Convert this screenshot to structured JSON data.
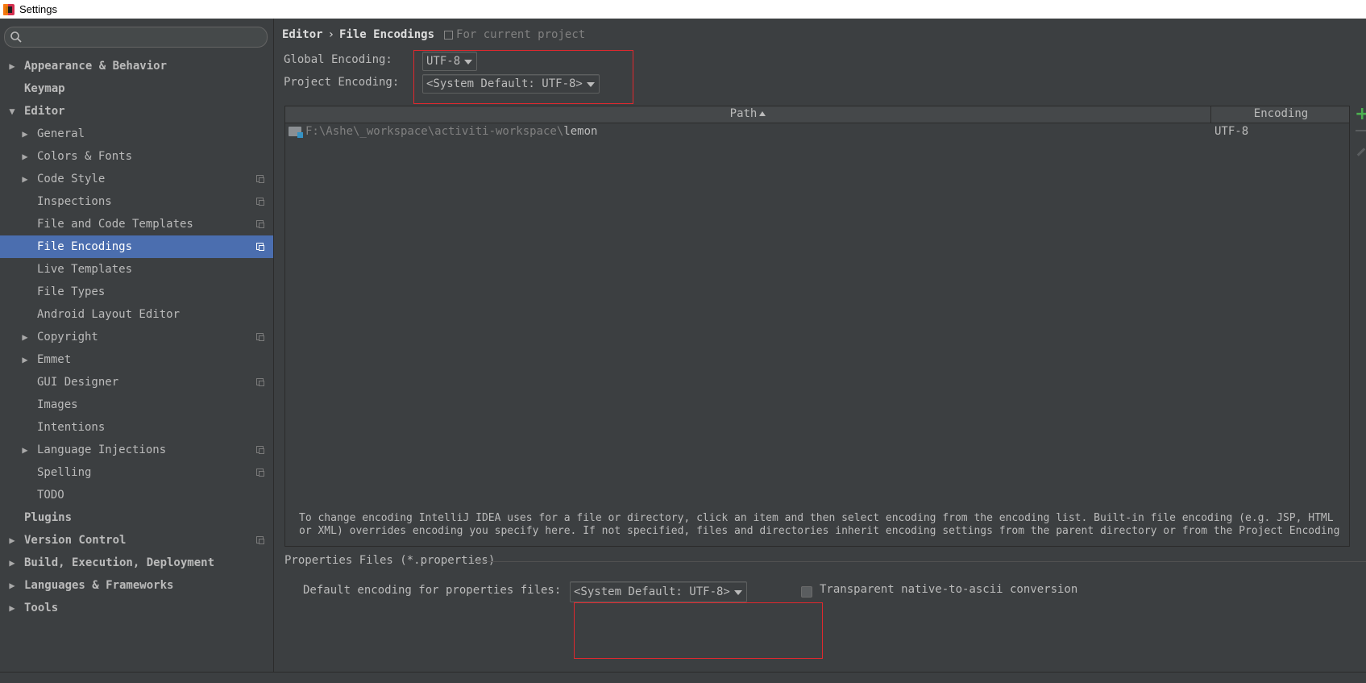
{
  "window": {
    "title": "Settings"
  },
  "search": {
    "placeholder": ""
  },
  "tree": [
    {
      "label": "Appearance & Behavior",
      "level": 0,
      "arrow": "right",
      "bold": true,
      "scope": false,
      "selected": false
    },
    {
      "label": "Keymap",
      "level": 0,
      "arrow": "none",
      "bold": true,
      "scope": false,
      "selected": false
    },
    {
      "label": "Editor",
      "level": 0,
      "arrow": "down",
      "bold": true,
      "scope": false,
      "selected": false
    },
    {
      "label": "General",
      "level": 1,
      "arrow": "right",
      "bold": false,
      "scope": false,
      "selected": false
    },
    {
      "label": "Colors & Fonts",
      "level": 1,
      "arrow": "right",
      "bold": false,
      "scope": false,
      "selected": false
    },
    {
      "label": "Code Style",
      "level": 1,
      "arrow": "right",
      "bold": false,
      "scope": true,
      "selected": false
    },
    {
      "label": "Inspections",
      "level": 1,
      "arrow": "none",
      "bold": false,
      "scope": true,
      "selected": false
    },
    {
      "label": "File and Code Templates",
      "level": 1,
      "arrow": "none",
      "bold": false,
      "scope": true,
      "selected": false
    },
    {
      "label": "File Encodings",
      "level": 1,
      "arrow": "none",
      "bold": false,
      "scope": true,
      "selected": true
    },
    {
      "label": "Live Templates",
      "level": 1,
      "arrow": "none",
      "bold": false,
      "scope": false,
      "selected": false
    },
    {
      "label": "File Types",
      "level": 1,
      "arrow": "none",
      "bold": false,
      "scope": false,
      "selected": false
    },
    {
      "label": "Android Layout Editor",
      "level": 1,
      "arrow": "none",
      "bold": false,
      "scope": false,
      "selected": false
    },
    {
      "label": "Copyright",
      "level": 1,
      "arrow": "right",
      "bold": false,
      "scope": true,
      "selected": false
    },
    {
      "label": "Emmet",
      "level": 1,
      "arrow": "right",
      "bold": false,
      "scope": false,
      "selected": false
    },
    {
      "label": "GUI Designer",
      "level": 1,
      "arrow": "none",
      "bold": false,
      "scope": true,
      "selected": false
    },
    {
      "label": "Images",
      "level": 1,
      "arrow": "none",
      "bold": false,
      "scope": false,
      "selected": false
    },
    {
      "label": "Intentions",
      "level": 1,
      "arrow": "none",
      "bold": false,
      "scope": false,
      "selected": false
    },
    {
      "label": "Language Injections",
      "level": 1,
      "arrow": "right",
      "bold": false,
      "scope": true,
      "selected": false
    },
    {
      "label": "Spelling",
      "level": 1,
      "arrow": "none",
      "bold": false,
      "scope": true,
      "selected": false
    },
    {
      "label": "TODO",
      "level": 1,
      "arrow": "none",
      "bold": false,
      "scope": false,
      "selected": false
    },
    {
      "label": "Plugins",
      "level": 0,
      "arrow": "none",
      "bold": true,
      "scope": false,
      "selected": false
    },
    {
      "label": "Version Control",
      "level": 0,
      "arrow": "right",
      "bold": true,
      "scope": true,
      "selected": false
    },
    {
      "label": "Build, Execution, Deployment",
      "level": 0,
      "arrow": "right",
      "bold": true,
      "scope": false,
      "selected": false
    },
    {
      "label": "Languages & Frameworks",
      "level": 0,
      "arrow": "right",
      "bold": true,
      "scope": false,
      "selected": false
    },
    {
      "label": "Tools",
      "level": 0,
      "arrow": "right",
      "bold": true,
      "scope": false,
      "selected": false
    }
  ],
  "breadcrumb": {
    "parent": "Editor",
    "separator": "›",
    "current": "File Encodings",
    "note": "For current project"
  },
  "global_encoding": {
    "label": "Global Encoding:",
    "value": "UTF-8"
  },
  "project_encoding": {
    "label": "Project Encoding:",
    "value": "<System Default: UTF-8>"
  },
  "table": {
    "columns": {
      "path": "Path",
      "encoding": "Encoding"
    },
    "rows": [
      {
        "path_prefix": "F:\\Ashe\\_workspace\\activiti-workspace\\",
        "path_leaf": "lemon",
        "encoding": "UTF-8"
      }
    ]
  },
  "toolbar": {
    "add": "+"
  },
  "info": {
    "line1": "To change encoding IntelliJ IDEA uses for a file or directory, click an item and then select encoding from the encoding list. Built-in file encoding (e.g. JSP, HTML",
    "line2": "or XML) overrides encoding you specify here. If not specified, files and directories inherit encoding settings from the parent directory or from the Project Encoding"
  },
  "properties": {
    "section_title": "Properties Files (*.properties)",
    "default_label": "Default encoding for properties files:",
    "default_value": "<System Default: UTF-8>",
    "transparent_label": "Transparent native-to-ascii conversion",
    "transparent_checked": false
  },
  "colors": {
    "background": "#3c3f41",
    "selection": "#4b6eaf",
    "highlight_box": "#e0282e",
    "add_green": "#4caf50"
  }
}
